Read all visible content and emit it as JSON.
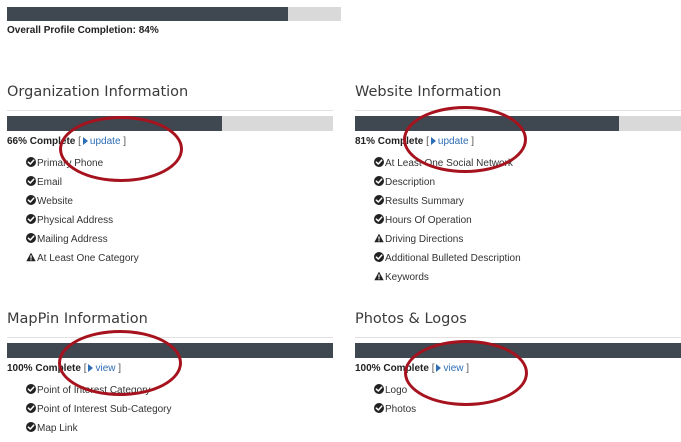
{
  "overall": {
    "label": "Overall Profile Completion: 84%",
    "percent": 84
  },
  "sections": [
    {
      "title": "Organization Information",
      "percent": 66,
      "complete_text": "66% Complete",
      "link_label": "update",
      "items": [
        {
          "label": "Primary Phone",
          "status": "check"
        },
        {
          "label": "Email",
          "status": "check"
        },
        {
          "label": "Website",
          "status": "check"
        },
        {
          "label": "Physical Address",
          "status": "check"
        },
        {
          "label": "Mailing Address",
          "status": "check"
        },
        {
          "label": "At Least One Category",
          "status": "warning"
        }
      ]
    },
    {
      "title": "Website Information",
      "percent": 81,
      "complete_text": "81% Complete",
      "link_label": "update",
      "items": [
        {
          "label": "At Least One Social Network",
          "status": "check"
        },
        {
          "label": "Description",
          "status": "check"
        },
        {
          "label": "Results Summary",
          "status": "check"
        },
        {
          "label": "Hours Of Operation",
          "status": "check"
        },
        {
          "label": "Driving Directions",
          "status": "warning"
        },
        {
          "label": "Additional Bulleted Description",
          "status": "check"
        },
        {
          "label": "Keywords",
          "status": "warning"
        }
      ]
    },
    {
      "title": "MapPin Information",
      "percent": 100,
      "complete_text": "100% Complete",
      "link_label": "view",
      "items": [
        {
          "label": "Point of Interest Category",
          "status": "check"
        },
        {
          "label": "Point of Interest Sub-Category",
          "status": "check"
        },
        {
          "label": "Map Link",
          "status": "check"
        }
      ]
    },
    {
      "title": "Photos & Logos",
      "percent": 100,
      "complete_text": "100% Complete",
      "link_label": "view",
      "items": [
        {
          "label": "Logo",
          "status": "check"
        },
        {
          "label": "Photos",
          "status": "check"
        }
      ]
    }
  ],
  "colors": {
    "bar_fill": "#3f4750",
    "bar_track": "#d9d9d9",
    "link": "#2d6db5",
    "annotation_ring": "#a6121d"
  }
}
